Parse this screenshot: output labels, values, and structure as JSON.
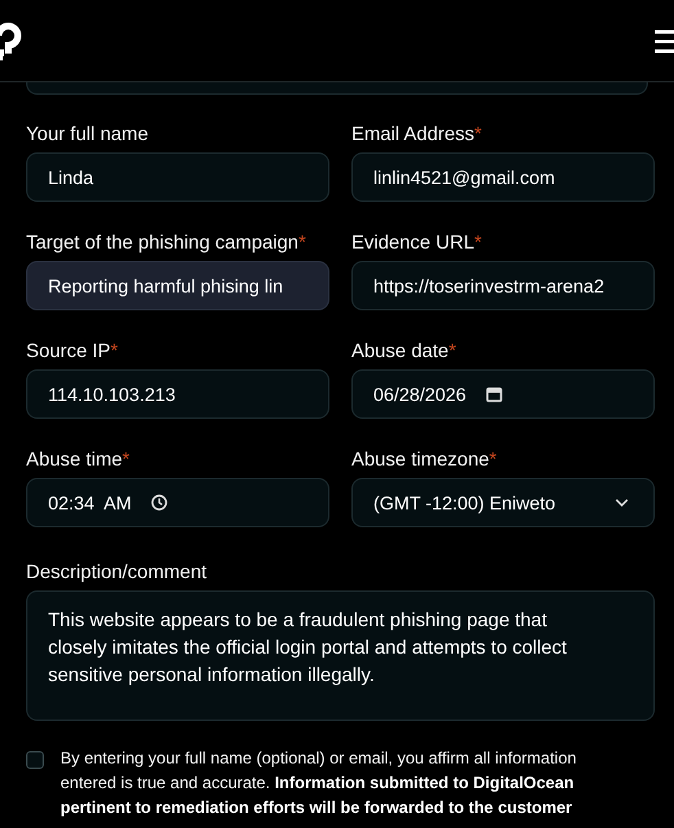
{
  "fields": [
    {
      "label": "Your full name",
      "kind": "text",
      "value": "Linda",
      "focused": false
    },
    {
      "label": "Email Address",
      "mark": "*",
      "kind": "text",
      "value": "linlin4521@gmail.com",
      "focused": false
    },
    {
      "label": "Target of the phishing campaign",
      "mark": "*",
      "kind": "text",
      "value": "Reporting harmful phising lin",
      "focused": true
    },
    {
      "label": "Evidence URL",
      "mark": "*",
      "kind": "text",
      "value": "https://toserinvestrm-arena2",
      "focused": false
    },
    {
      "label": "Source IP",
      "mark": "*",
      "kind": "text",
      "value": "114.10.103.213",
      "focused": false
    },
    {
      "label": "Abuse date",
      "mark": "*",
      "kind": "date",
      "value": "06/28/2026",
      "focused": false
    },
    {
      "label": "Abuse time",
      "mark": "*",
      "kind": "time",
      "value": "02:34  AM",
      "focused": false
    },
    {
      "label": "Abuse timezone",
      "mark": "*",
      "kind": "select",
      "value": "(GMT -12:00) Eniweto",
      "focused": false
    }
  ],
  "description": {
    "label": "Description/comment",
    "value": "This website appears to be a fraudulent phishing page that closely imitates the official login portal and attempts to collect sensitive personal information illegally."
  },
  "consent": {
    "checked": false,
    "text": "By entering your full name (optional) or email, you affirm all information entered is true and accurate. **Information submitted to DigitalOcean pertinent to remediation efforts will be forwarded to the customer**"
  }
}
